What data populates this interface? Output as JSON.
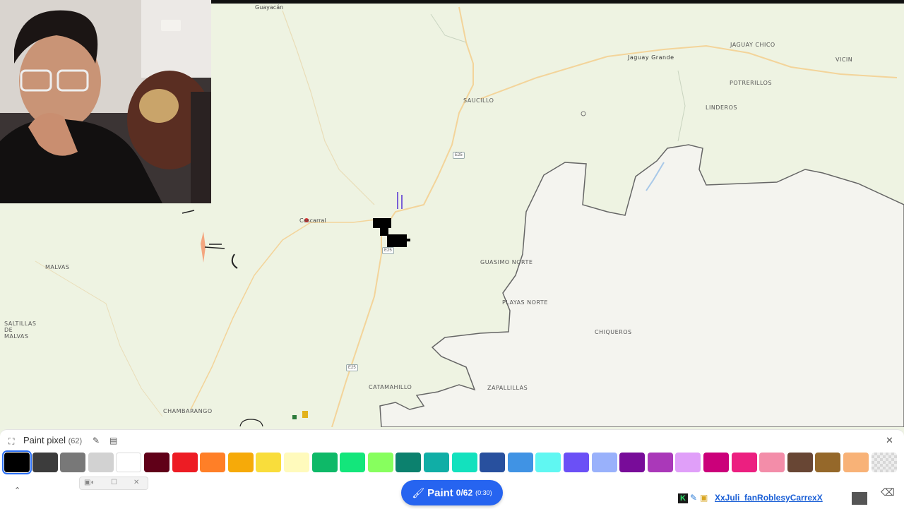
{
  "map": {
    "labels": {
      "guayacan": "Guayacán",
      "jaguay_grande": "Jaguay Grande",
      "jaguay_chico": "JAGUAY CHICO",
      "vicin": "VICIN",
      "potrerillos": "POTRERILLOS",
      "linderos": "LINDEROS",
      "sauciillo": "SAUCILLO",
      "cascarral": "Cascarral",
      "malvas": "MALVAS",
      "saltillas": "SALTILLAS DE MALVAS",
      "guasimo_norte": "GUASIMO NORTE",
      "playas_norte": "PLAYAS NORTE",
      "chiqueros": "CHIQUEROS",
      "catamahillo": "CATAMAHILLO",
      "zapallillas": "ZAPALLILLAS",
      "chamarango": "CHAMBARANGO"
    },
    "road_shields": [
      "E25",
      "E25",
      "E25"
    ]
  },
  "panel": {
    "title": "Paint pixel",
    "count": "(62)",
    "palette": [
      "#000000",
      "#3c3c3c",
      "#787878",
      "#d2d2d2",
      "#ffffff",
      "#600018",
      "#ed1c24",
      "#ff7f27",
      "#f6aa09",
      "#f9dd3b",
      "#fffabc",
      "#0eb968",
      "#13e67b",
      "#87ff5e",
      "#0c816e",
      "#10aea6",
      "#13e1be",
      "#28509e",
      "#4093e4",
      "#60f7f2",
      "#6b50f6",
      "#99b1fb",
      "#780c99",
      "#aa38b9",
      "#e09ff9",
      "#cb007a",
      "#ec1f80",
      "#f38da9",
      "#684634",
      "#95682a",
      "#f8b277",
      "transparent"
    ],
    "selected_index": 0,
    "paint_button": {
      "label": "Paint",
      "count": "0/62",
      "timer": "(0:30)"
    },
    "user": {
      "name": "XxJuli_fanRoblesyCarrexX"
    }
  }
}
